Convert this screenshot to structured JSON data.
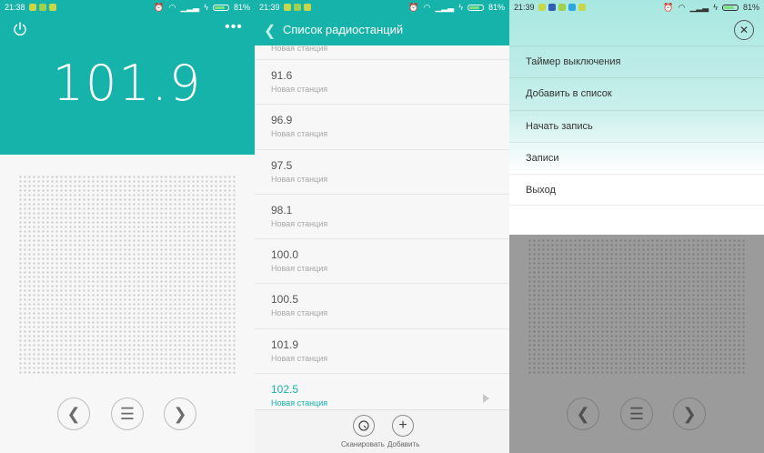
{
  "panel1": {
    "status": {
      "time": "21:38",
      "battery": "81%",
      "battery_level": 0.81
    },
    "frequency": "101.9",
    "icons": {
      "power": "power-icon",
      "more": "more-icon",
      "prev": "chevron-left-icon",
      "menu": "menu-icon",
      "next": "chevron-right-icon"
    },
    "more_glyph": "•••"
  },
  "panel2": {
    "status": {
      "time": "21:39",
      "battery": "81%",
      "battery_level": 0.81
    },
    "title": "Список радиостанций",
    "stations": [
      {
        "freq": "",
        "name": "Новая станция"
      },
      {
        "freq": "91.6",
        "name": "Новая станция"
      },
      {
        "freq": "96.9",
        "name": "Новая станция"
      },
      {
        "freq": "97.5",
        "name": "Новая станция"
      },
      {
        "freq": "98.1",
        "name": "Новая станция"
      },
      {
        "freq": "100.0",
        "name": "Новая станция"
      },
      {
        "freq": "100.5",
        "name": "Новая станция"
      },
      {
        "freq": "101.9",
        "name": "Новая станция"
      },
      {
        "freq": "102.5",
        "name": "Новая станция"
      }
    ],
    "scan_label": "Сканировать",
    "add_label": "Добавить"
  },
  "panel3": {
    "status": {
      "time": "21:39",
      "battery": "81%",
      "battery_level": 0.81
    },
    "menu": [
      "Таймер выключения",
      "Добавить в список",
      "Начать запись",
      "Записи",
      "Выход"
    ]
  },
  "colors": {
    "accent": "#16b3aa",
    "active_station": "#16b3aa",
    "battery": "#7fe07f"
  }
}
